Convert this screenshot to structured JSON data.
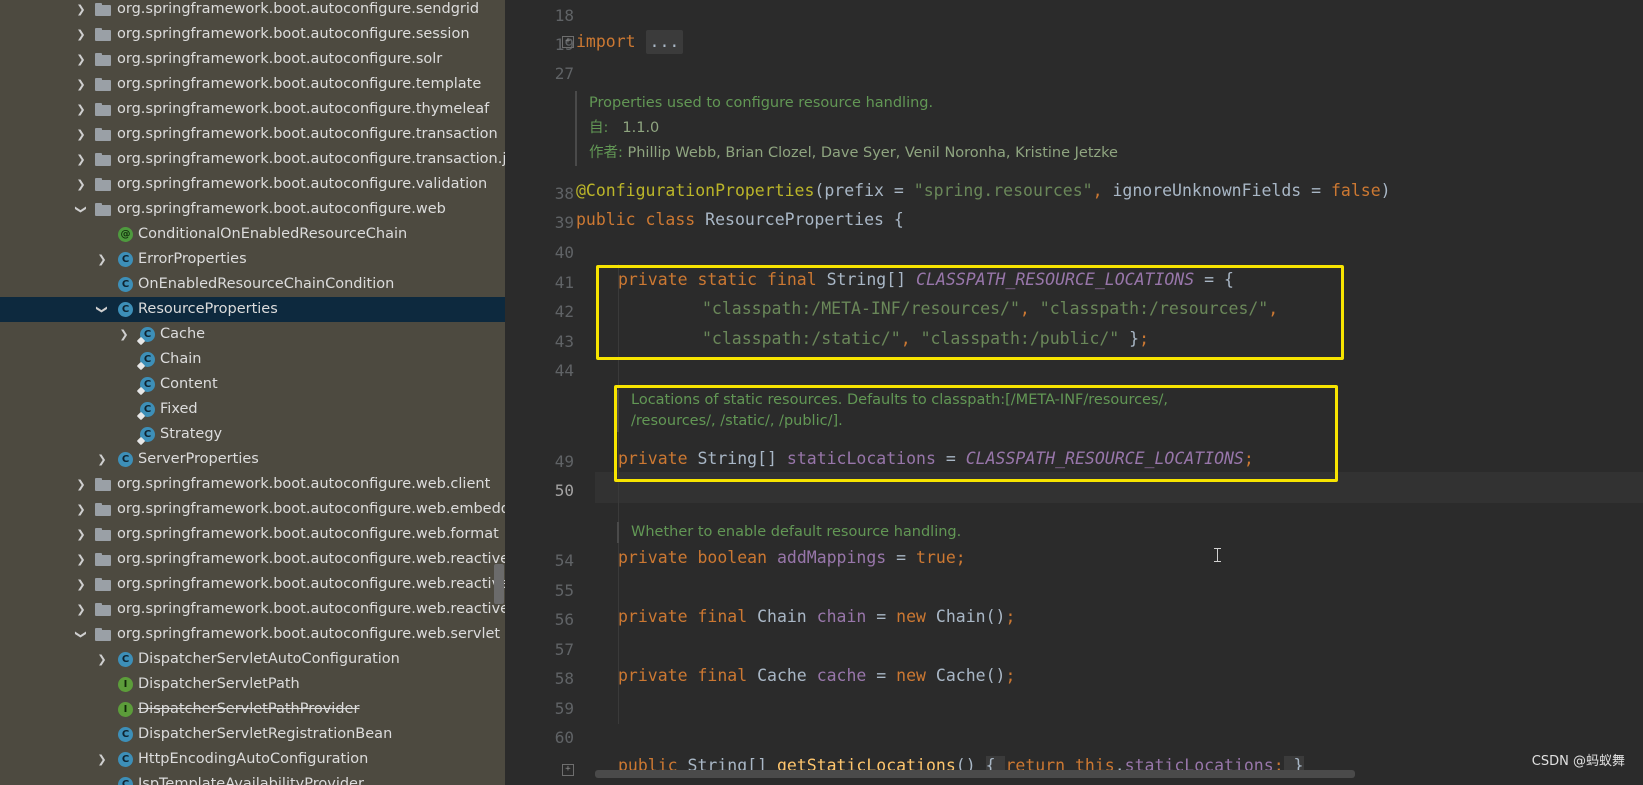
{
  "tree": {
    "rows": [
      {
        "label": "org.springframework.boot.autoconfigure.sendgrid",
        "kind": "package",
        "level": 0,
        "chevron": "closed"
      },
      {
        "label": "org.springframework.boot.autoconfigure.session",
        "kind": "package",
        "level": 0,
        "chevron": "closed"
      },
      {
        "label": "org.springframework.boot.autoconfigure.solr",
        "kind": "package",
        "level": 0,
        "chevron": "closed"
      },
      {
        "label": "org.springframework.boot.autoconfigure.template",
        "kind": "package",
        "level": 0,
        "chevron": "closed"
      },
      {
        "label": "org.springframework.boot.autoconfigure.thymeleaf",
        "kind": "package",
        "level": 0,
        "chevron": "closed"
      },
      {
        "label": "org.springframework.boot.autoconfigure.transaction",
        "kind": "package",
        "level": 0,
        "chevron": "closed"
      },
      {
        "label": "org.springframework.boot.autoconfigure.transaction.jta",
        "kind": "package",
        "level": 0,
        "chevron": "closed"
      },
      {
        "label": "org.springframework.boot.autoconfigure.validation",
        "kind": "package",
        "level": 0,
        "chevron": "closed"
      },
      {
        "label": "org.springframework.boot.autoconfigure.web",
        "kind": "package",
        "level": 0,
        "chevron": "open"
      },
      {
        "label": "ConditionalOnEnabledResourceChain",
        "kind": "annotation",
        "level": 1,
        "chevron": "none"
      },
      {
        "label": "ErrorProperties",
        "kind": "class",
        "level": 1,
        "chevron": "closed"
      },
      {
        "label": "OnEnabledResourceChainCondition",
        "kind": "class",
        "level": 1,
        "chevron": "none"
      },
      {
        "label": "ResourceProperties",
        "kind": "class",
        "level": 1,
        "chevron": "open",
        "selected": true
      },
      {
        "label": "Cache",
        "kind": "inner",
        "level": 2,
        "chevron": "closed"
      },
      {
        "label": "Chain",
        "kind": "inner",
        "level": 2,
        "chevron": "none"
      },
      {
        "label": "Content",
        "kind": "inner",
        "level": 2,
        "chevron": "none"
      },
      {
        "label": "Fixed",
        "kind": "inner",
        "level": 2,
        "chevron": "none"
      },
      {
        "label": "Strategy",
        "kind": "inner",
        "level": 2,
        "chevron": "none"
      },
      {
        "label": "ServerProperties",
        "kind": "class",
        "level": 1,
        "chevron": "closed"
      },
      {
        "label": "org.springframework.boot.autoconfigure.web.client",
        "kind": "package",
        "level": 0,
        "chevron": "closed"
      },
      {
        "label": "org.springframework.boot.autoconfigure.web.embedded",
        "kind": "package",
        "level": 0,
        "chevron": "closed"
      },
      {
        "label": "org.springframework.boot.autoconfigure.web.format",
        "kind": "package",
        "level": 0,
        "chevron": "closed"
      },
      {
        "label": "org.springframework.boot.autoconfigure.web.reactive",
        "kind": "package",
        "level": 0,
        "chevron": "closed"
      },
      {
        "label": "org.springframework.boot.autoconfigure.web.reactive.erro",
        "kind": "package",
        "level": 0,
        "chevron": "closed"
      },
      {
        "label": "org.springframework.boot.autoconfigure.web.reactive.fur",
        "kind": "package",
        "level": 0,
        "chevron": "closed"
      },
      {
        "label": "org.springframework.boot.autoconfigure.web.servlet",
        "kind": "package",
        "level": 0,
        "chevron": "open"
      },
      {
        "label": "DispatcherServletAutoConfiguration",
        "kind": "class",
        "level": 1,
        "chevron": "closed"
      },
      {
        "label": "DispatcherServletPath",
        "kind": "interface",
        "level": 1,
        "chevron": "none"
      },
      {
        "label": "DispatcherServletPathProvider",
        "kind": "interface",
        "level": 1,
        "chevron": "none",
        "strike": true
      },
      {
        "label": "DispatcherServletRegistrationBean",
        "kind": "class",
        "level": 1,
        "chevron": "none"
      },
      {
        "label": "HttpEncodingAutoConfiguration",
        "kind": "class",
        "level": 1,
        "chevron": "closed"
      },
      {
        "label": "JspTemplateAvailabilityProvider",
        "kind": "class",
        "level": 1,
        "chevron": "none"
      }
    ]
  },
  "editor": {
    "line_numbers": [
      "18",
      "19",
      "27",
      "38",
      "39",
      "40",
      "41",
      "42",
      "43",
      "44",
      "49",
      "50",
      "54",
      "55",
      "56",
      "57",
      "58",
      "59",
      "60"
    ],
    "current_line": "50",
    "import_keyword": "import",
    "import_fold": "...",
    "doc_class": {
      "line1": "Properties used to configure resource handling.",
      "since_label": "自:",
      "since_value": "1.1.0",
      "author_label": "作者:",
      "author_value": "Phillip Webb, Brian Clozel, Dave Syer, Venil Noronha, Kristine Jetzke"
    },
    "annotation": {
      "name": "@ConfigurationProperties",
      "open": "(",
      "arg1_name": "prefix = ",
      "arg1_value": "\"spring.resources\"",
      "comma": ", ",
      "arg2_name": "ignoreUnknownFields = ",
      "arg2_value": "false",
      "close": ")"
    },
    "class_decl": {
      "kw": "public class",
      "name": " ResourceProperties {"
    },
    "const_decl": {
      "kw": "private static final",
      "type": " String[] ",
      "name": "CLASSPATH_RESOURCE_LOCATIONS",
      "rest": " = {",
      "v1": "\"classpath:/META-INF/resources/\"",
      "v2": "\"classpath:/resources/\"",
      "v3": "\"classpath:/static/\"",
      "v4": "\"classpath:/public/\"",
      "sep": ", ",
      "close": " }",
      "semi": ";"
    },
    "doc_static": {
      "line1": "Locations of static resources. Defaults to classpath:[/META-INF/resources/,",
      "line2": "/resources/, /static/, /public/]."
    },
    "static_decl": {
      "kw": "private",
      "type": " String[] ",
      "name": "staticLocations",
      "eq": " = ",
      "value": "CLASSPATH_RESOURCE_LOCATIONS",
      "semi": ";"
    },
    "doc_mappings": {
      "line1": "Whether to enable default resource handling."
    },
    "mappings_decl": {
      "kw": "private boolean",
      "name": "addMappings",
      "eq": " = ",
      "value": "true",
      "semi": ";"
    },
    "chain_decl": {
      "kw": "private final",
      "type": " Chain ",
      "name": "chain",
      "eq": " = ",
      "new": "new",
      "call": " Chain()",
      "semi": ";"
    },
    "cache_decl": {
      "kw": "private final",
      "type": " Cache ",
      "name": "cache",
      "eq": " = ",
      "new": "new",
      "call": " Cache()",
      "semi": ";"
    },
    "getter_decl": {
      "kw": "public",
      "type": " String[] ",
      "name": "getStaticLocations",
      "paren": "() ",
      "body_open": "{ ",
      "ret": "return this",
      "dot": ".",
      "field": "staticLocations",
      "semi": ";",
      "body_close": " }"
    }
  },
  "watermark": "CSDN @蚂蚁舞",
  "colors": {
    "keyword": "#cc7832",
    "string": "#6a8759",
    "constant": "#9876aa",
    "doc": "#629755",
    "highlight": "#f7e400",
    "selection": "#0d293e"
  }
}
